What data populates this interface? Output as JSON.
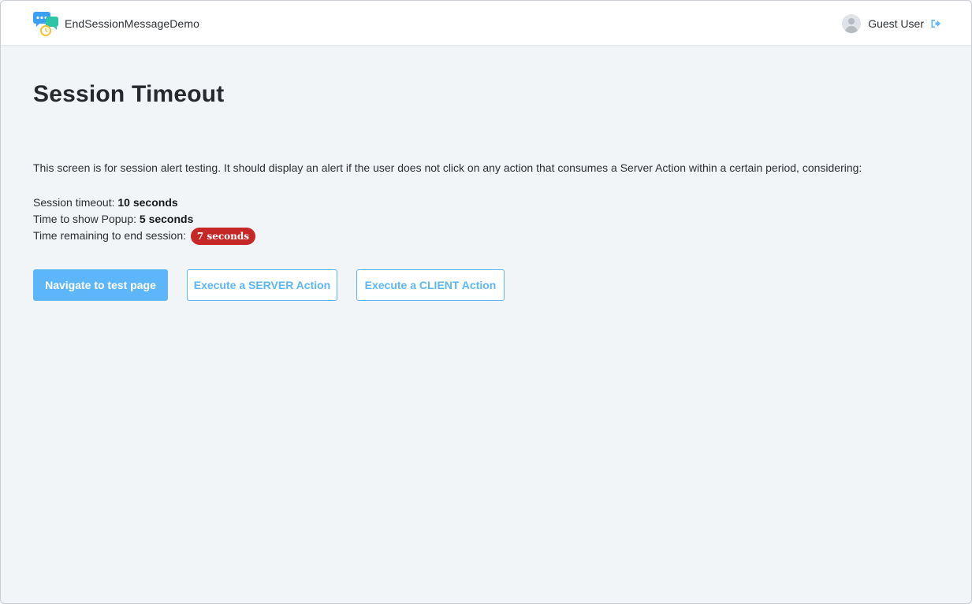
{
  "header": {
    "app_name": "EndSessionMessageDemo",
    "user_name": "Guest User"
  },
  "page": {
    "title": "Session Timeout",
    "description": "This screen is for session alert testing. It should display an alert if the user does not click on any action that consumes a Server Action within a certain period, considering:",
    "session_timeout_label": "Session timeout:",
    "session_timeout_value": "10 seconds",
    "popup_time_label": "Time to show Popup:",
    "popup_time_value": "5 seconds",
    "remaining_label": "Time remaining to end session:",
    "remaining_value": "7 seconds"
  },
  "actions": {
    "navigate_label": "Navigate to test page",
    "server_label": "Execute a SERVER Action",
    "client_label": "Execute a CLIENT Action"
  },
  "colors": {
    "accent": "#5db6f9",
    "badge": "#c62828",
    "background": "#f2f5f8"
  },
  "icons": {
    "logo": "chat-bubbles-clock-icon",
    "avatar": "user-avatar-icon",
    "logout": "logout-icon"
  }
}
